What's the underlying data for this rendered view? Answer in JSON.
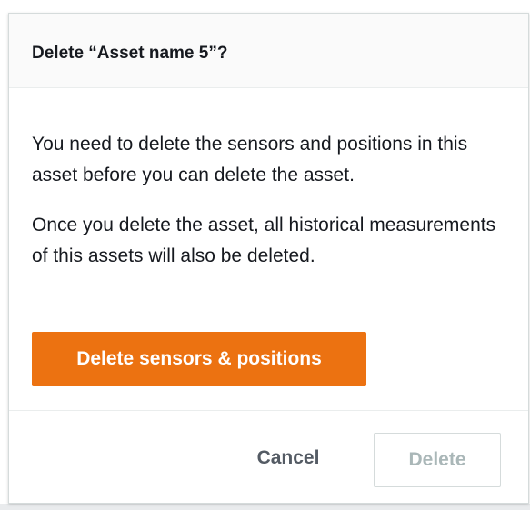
{
  "dialog": {
    "title": "Delete “Asset name 5”?",
    "body": {
      "paragraph_1": "You need to delete the sensors and positions in this asset before you can delete the asset.",
      "paragraph_2": "Once you delete the asset, all historical measurements of this assets will also be deleted."
    },
    "primary_action_label": "Delete sensors & positions",
    "footer": {
      "cancel_label": "Cancel",
      "delete_label": "Delete",
      "delete_disabled": true
    }
  },
  "colors": {
    "primary_button": "#ec7211",
    "text": "#16191f",
    "disabled_text": "#aab7b8",
    "secondary_text": "#545b64"
  }
}
